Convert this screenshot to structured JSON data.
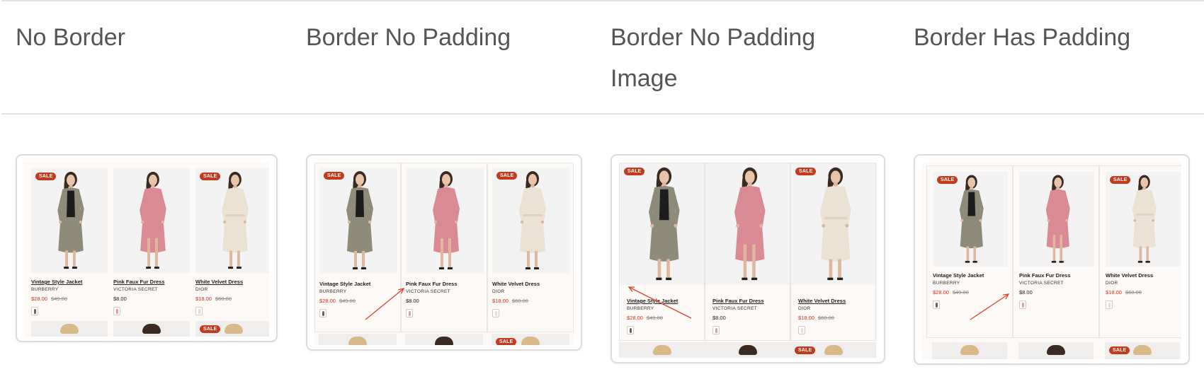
{
  "columns": [
    {
      "title": "No Border"
    },
    {
      "title": "Border No Padding"
    },
    {
      "title": "Border No Padding Image"
    },
    {
      "title": "Border Has Padding"
    }
  ],
  "sale_label": "SALE",
  "products": [
    {
      "name": "Vintage Style Jacket",
      "brand": "BURBERRY",
      "price": "$28.00",
      "old_price": "$49.00",
      "on_sale": true,
      "dress_color": "#8f8b79",
      "swatch_color": "#6b6558"
    },
    {
      "name": "Pink Faux Fur Dress",
      "brand": "VICTORIA SECRET",
      "price": "$8.00",
      "old_price": "",
      "on_sale": false,
      "dress_color": "#d98a93",
      "swatch_color": "#e79aa2"
    },
    {
      "name": "White Velvet Dress",
      "brand": "DIOR",
      "price": "$18.00",
      "old_price": "$60.00",
      "on_sale": true,
      "dress_color": "#ece2d3",
      "swatch_color": "#e8dccb"
    }
  ],
  "colors": {
    "sale_badge": "#c43a1c",
    "sale_price": "#d2301c",
    "arrow": "#e0412b",
    "card_border": "#dcdcdc",
    "card_background": "#fdf9f6"
  }
}
